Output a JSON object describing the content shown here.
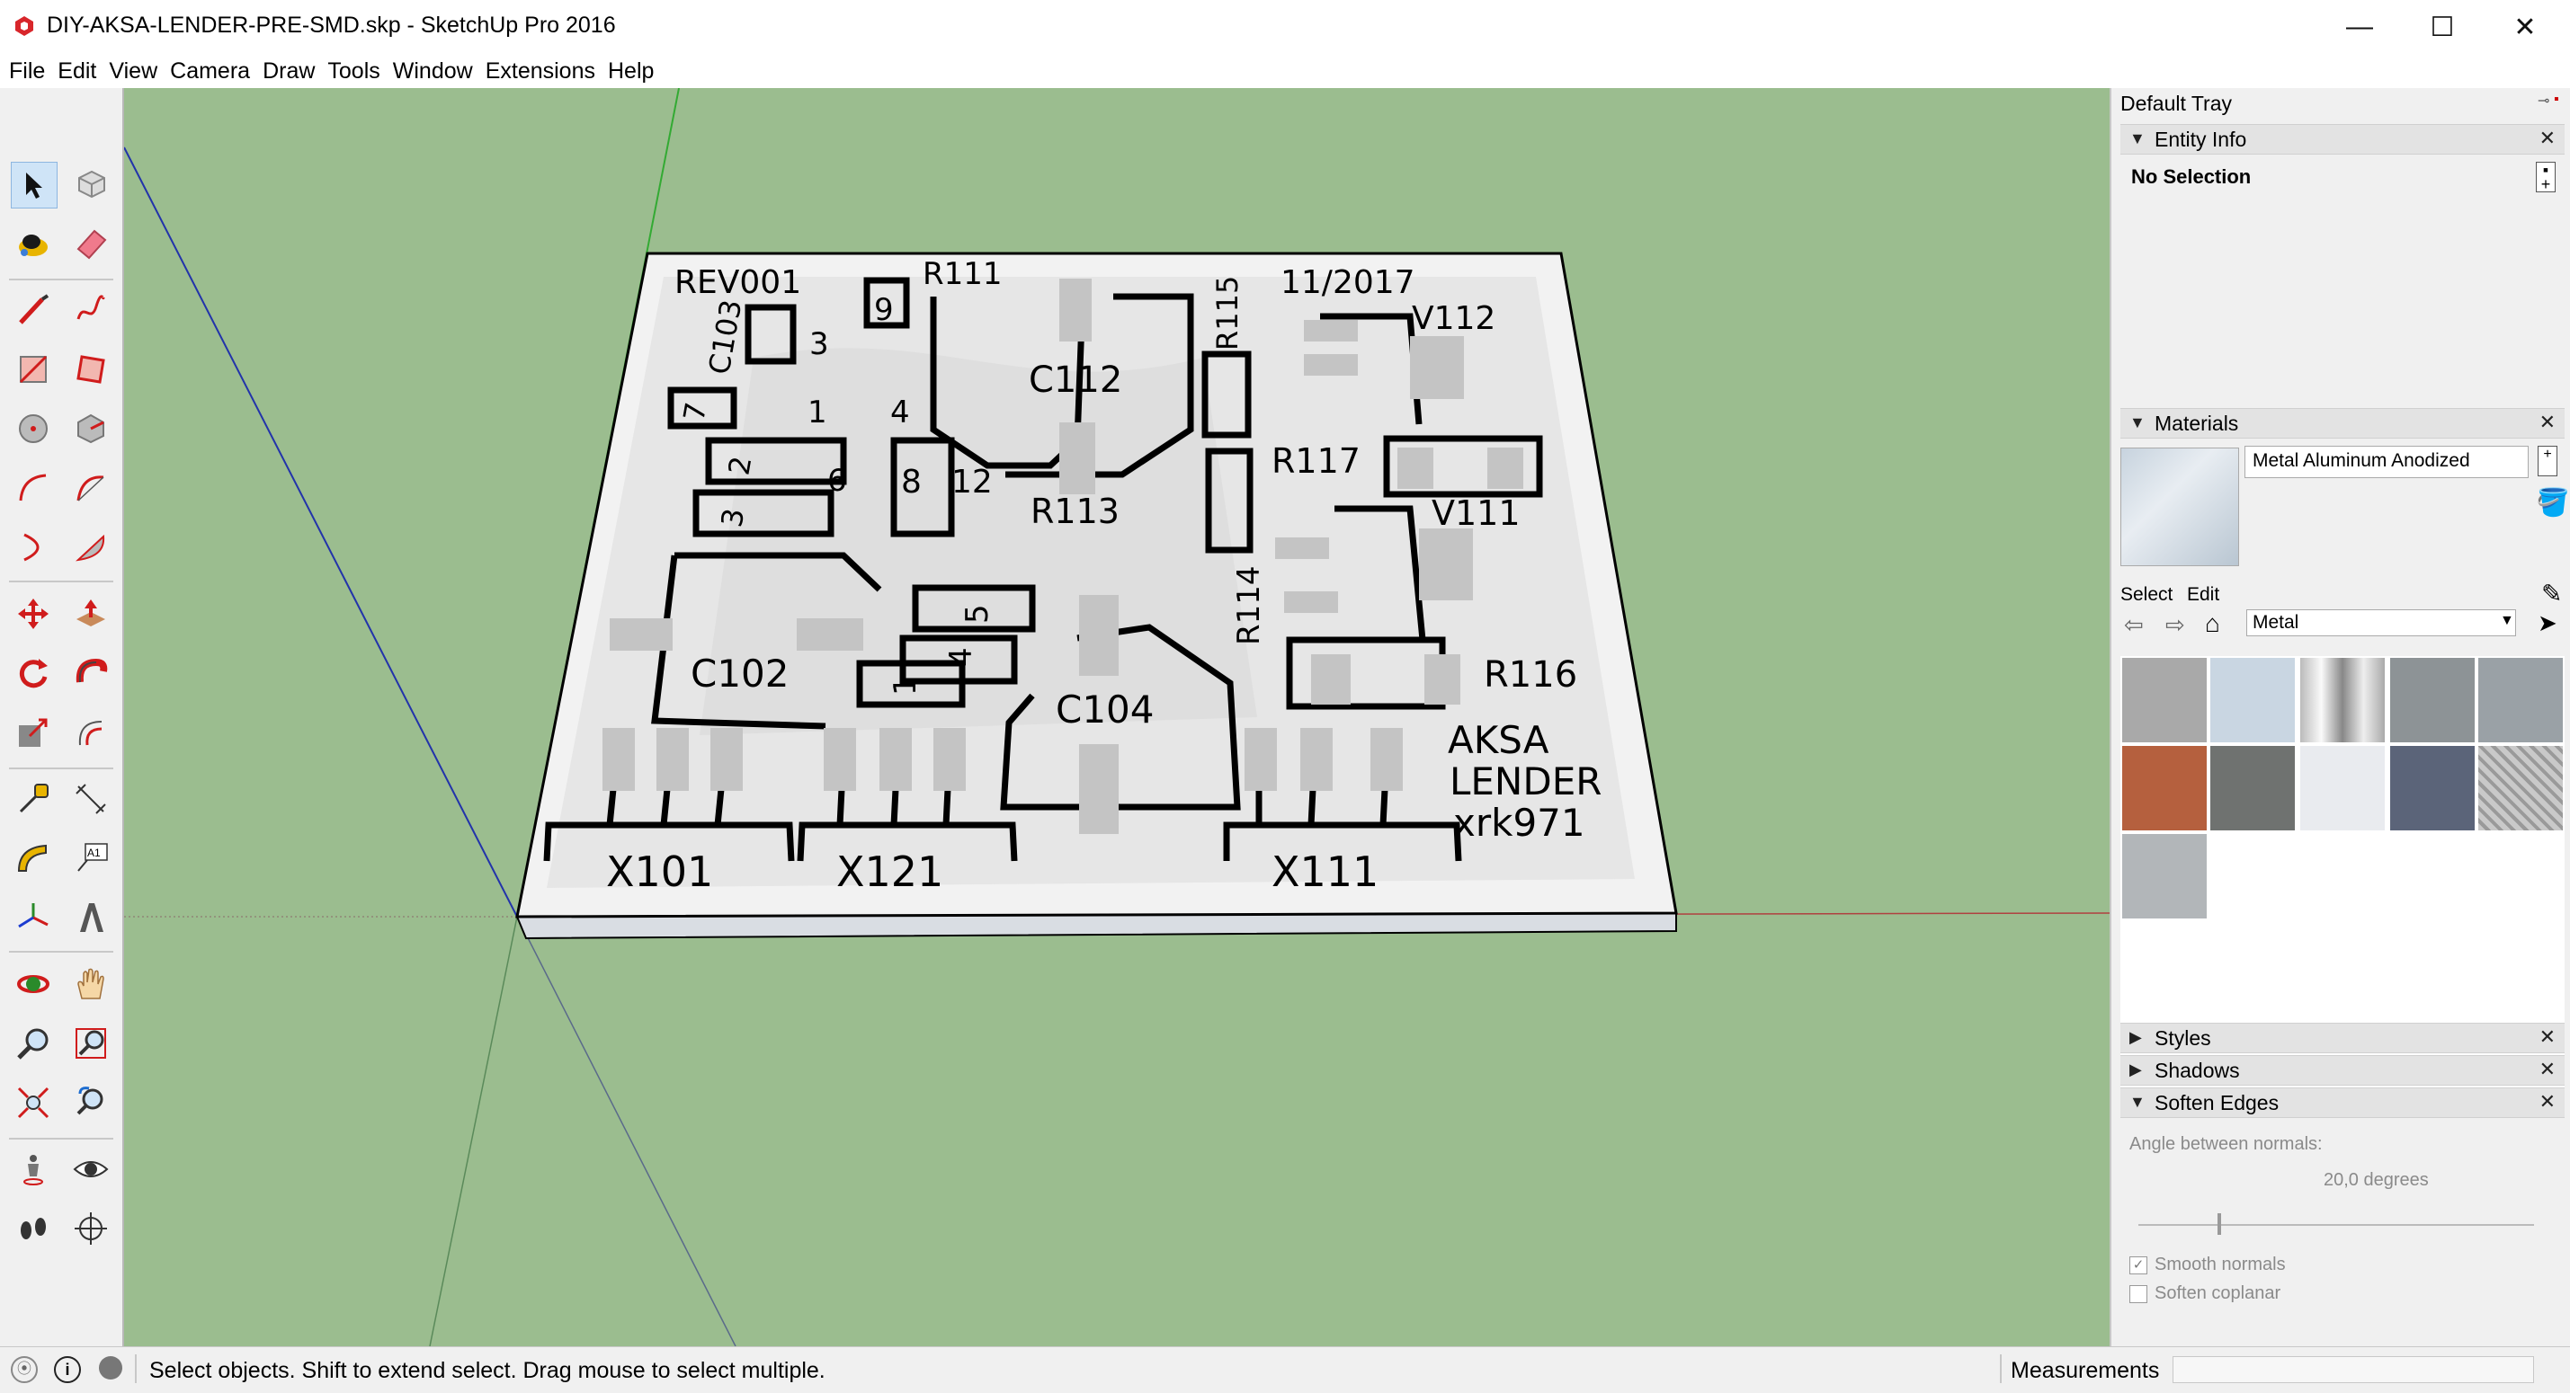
{
  "window": {
    "title": "DIY-AKSA-LENDER-PRE-SMD.skp - SketchUp Pro 2016",
    "minimize_glyph": "—",
    "maximize_glyph": "☐",
    "close_glyph": "✕"
  },
  "menu": [
    "File",
    "Edit",
    "View",
    "Camera",
    "Draw",
    "Tools",
    "Window",
    "Extensions",
    "Help"
  ],
  "tools": [
    "select-tool-icon",
    "component-tool-icon",
    "paint-bucket-icon",
    "eraser-icon",
    "pencil-line-icon",
    "freehand-icon",
    "rectangle-icon",
    "rotated-rectangle-icon",
    "circle-icon",
    "polygon-icon",
    "arc-icon",
    "two-point-arc-icon",
    "three-point-arc-icon",
    "pie-icon",
    "move-icon",
    "push-pull-icon",
    "rotate-icon",
    "follow-me-icon",
    "scale-icon",
    "offset-icon",
    "tape-measure-icon",
    "dimension-icon",
    "protractor-icon",
    "text-icon",
    "axes-icon",
    "3d-text-icon",
    "orbit-icon",
    "pan-icon",
    "zoom-icon",
    "zoom-window-icon",
    "zoom-extents-icon",
    "previous-view-icon",
    "position-camera-icon",
    "look-around-icon",
    "walk-icon",
    "section-plane-icon"
  ],
  "board": {
    "labels": [
      "REV001",
      "R111",
      "11/2017",
      "C103",
      "3",
      "9",
      "R115",
      "V112",
      "C112",
      "7",
      "1",
      "4",
      "2",
      "6",
      "8",
      "12",
      "R117",
      "3",
      "R113",
      "V111",
      "R114",
      "5",
      "4",
      "1",
      "C102",
      "C104",
      "R116",
      "AKSA",
      "LENDER",
      "xrk971",
      "X101",
      "X121",
      "X111"
    ]
  },
  "tray": {
    "title": "Default Tray",
    "entity_info": {
      "header": "Entity Info",
      "selection": "No Selection"
    },
    "materials": {
      "header": "Materials",
      "material_name": "Metal Aluminum Anodized",
      "tab_select": "Select",
      "tab_edit": "Edit",
      "collection": "Metal",
      "swatch_colors": [
        "#a9a9a9",
        "#c9d6e2",
        "#9a9a9a",
        "#8d9396",
        "#9aa1a6",
        "#b5603e",
        "#6f7270",
        "#e9ebef",
        "#5b6479",
        "#b8b8b8",
        "#b2b6b9"
      ]
    },
    "styles_header": "Styles",
    "shadows_header": "Shadows",
    "soften_edges": {
      "header": "Soften Edges",
      "angle_label": "Angle between normals:",
      "angle_value": "20,0  degrees",
      "angle_fraction": 0.2,
      "smooth_normals": "Smooth normals",
      "smooth_normals_checked": true,
      "soften_coplanar": "Soften coplanar",
      "soften_coplanar_checked": false
    }
  },
  "status": {
    "message": "Select objects. Shift to extend select. Drag mouse to select multiple.",
    "measurements_label": "Measurements"
  }
}
